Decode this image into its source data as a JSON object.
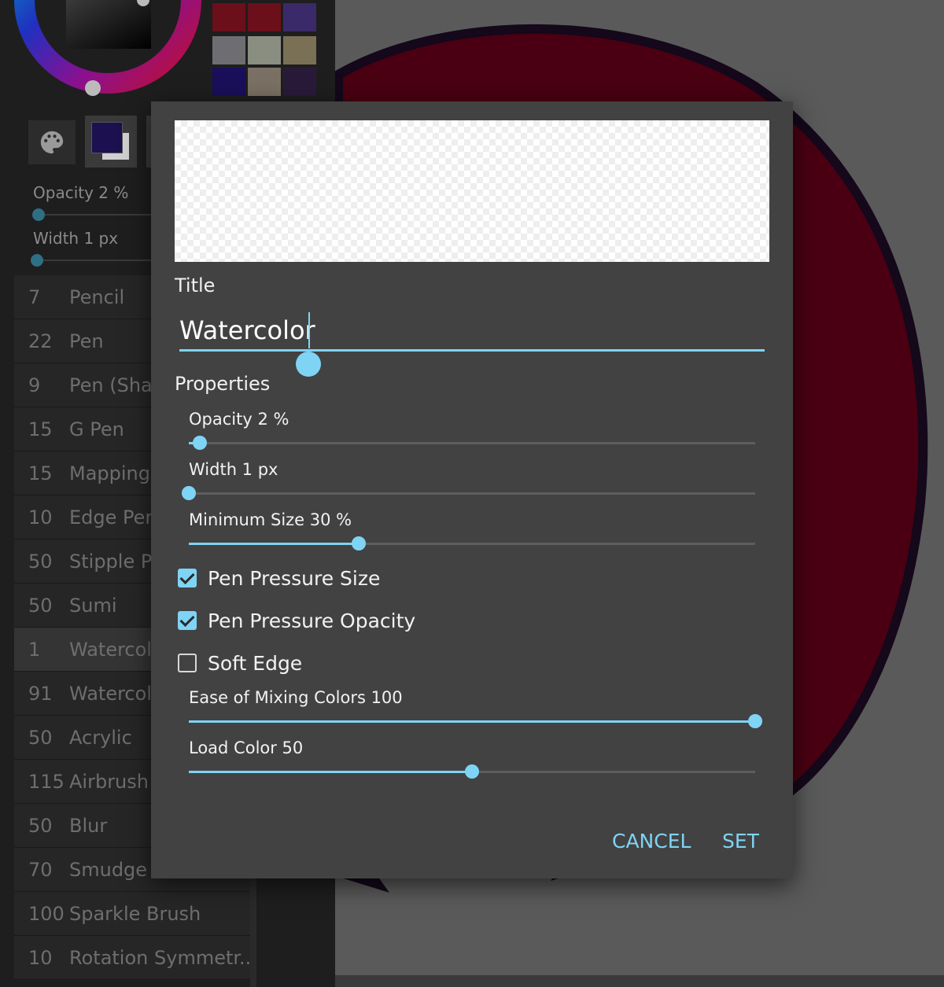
{
  "panel": {
    "opacity_label": "Opacity 2 %",
    "width_label": "Width 1 px",
    "brushes": [
      {
        "size": "7",
        "name": "Pencil"
      },
      {
        "size": "22",
        "name": "Pen"
      },
      {
        "size": "9",
        "name": "Pen (Shar"
      },
      {
        "size": "15",
        "name": "G Pen"
      },
      {
        "size": "15",
        "name": "Mapping"
      },
      {
        "size": "10",
        "name": "Edge Pen"
      },
      {
        "size": "50",
        "name": "Stipple P"
      },
      {
        "size": "50",
        "name": "Sumi"
      },
      {
        "size": "1",
        "name": "Watercol"
      },
      {
        "size": "91",
        "name": "Watercol"
      },
      {
        "size": "50",
        "name": "Acrylic"
      },
      {
        "size": "115",
        "name": "Airbrush"
      },
      {
        "size": "50",
        "name": "Blur"
      },
      {
        "size": "70",
        "name": "Smudge"
      },
      {
        "size": "100",
        "name": "Sparkle Brush"
      },
      {
        "size": "10",
        "name": "Rotation Symmetr..."
      }
    ],
    "selected_brush_index": 8,
    "swatch_colors": [
      "#6b0f1a",
      "#6b0f1a",
      "#3a2a6a",
      "#6e6e72",
      "#8a8e80",
      "#7a7056",
      "#1a0f5a",
      "#7a7064",
      "#2a1a3a"
    ],
    "current_color": "#1d1050",
    "palette_icon": "palette-icon"
  },
  "dialog": {
    "title_label": "Title",
    "title_value": "Watercolor",
    "properties_label": "Properties",
    "sliders": [
      {
        "label": "Opacity 2 %",
        "value": 0.02
      },
      {
        "label": "Width 1 px",
        "value": 0.0
      },
      {
        "label": "Minimum Size 30 %",
        "value": 0.3
      },
      {
        "label": "Ease of Mixing Colors 100",
        "value": 1.0
      },
      {
        "label": "Load Color 50",
        "value": 0.5
      }
    ],
    "checkboxes": [
      {
        "label": "Pen Pressure Size",
        "checked": true
      },
      {
        "label": "Pen Pressure Opacity",
        "checked": true
      },
      {
        "label": "Soft Edge",
        "checked": false
      }
    ],
    "cancel_label": "CANCEL",
    "set_label": "SET"
  },
  "colors": {
    "accent": "#7fd4f5",
    "dialog_bg": "#424242",
    "canvas_shape": "#4a0012"
  }
}
